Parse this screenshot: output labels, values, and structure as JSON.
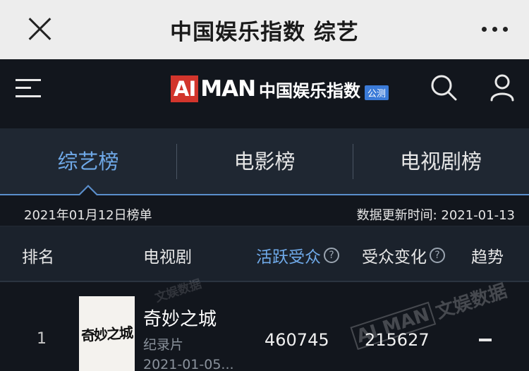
{
  "wechat_bar": {
    "title": "中国娱乐指数 综艺"
  },
  "app_header": {
    "logo_ai": "AI",
    "logo_man": "MAN",
    "logo_cn": "中国娱乐指数",
    "logo_badge": "公测"
  },
  "tabs": [
    {
      "label": "综艺榜",
      "active": true
    },
    {
      "label": "电影榜",
      "active": false
    },
    {
      "label": "电视剧榜",
      "active": false
    }
  ],
  "info": {
    "list_date": "2021年01月12日榜单",
    "updated": "数据更新时间: 2021-01-13"
  },
  "table": {
    "headers": {
      "rank": "排名",
      "show": "电视剧",
      "active_audience": "活跃受众",
      "audience_change": "受众变化",
      "trend": "趋势"
    },
    "help_mark": "?",
    "rows": [
      {
        "rank": "1",
        "poster_title": "奇妙之城",
        "name": "奇妙之城",
        "type": "纪录片",
        "date": "2021-01-05...",
        "active_audience": "460745",
        "audience_change": "215627",
        "trend": "flat"
      }
    ]
  },
  "watermark": {
    "brand": "AI MAN",
    "text": "文娱数据"
  },
  "colors": {
    "accent": "#6fa9e8",
    "logo_red": "#d2352c",
    "badge_blue": "#3b7bd8",
    "background": "#12161d",
    "tab_bg": "#1f2732"
  }
}
